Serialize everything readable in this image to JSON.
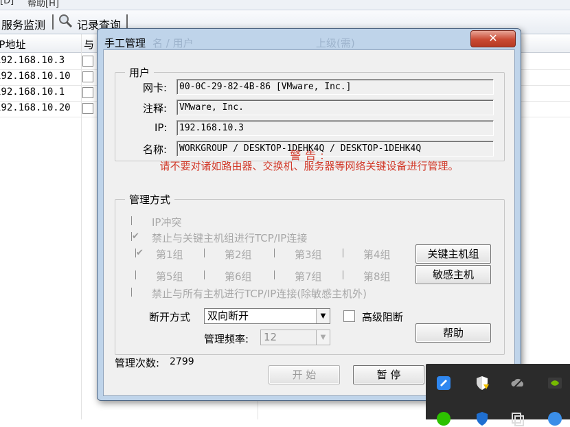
{
  "app": {
    "menubar": {
      "item1": "[D]",
      "item2": "帮助[H]"
    },
    "toolbar": {
      "service_monitor": "服务监测",
      "record_query": "记录查询"
    },
    "grid": {
      "headers": [
        "IP地址",
        "与"
      ],
      "rows": [
        "192.168.10.3",
        "192.168.10.10",
        "192.168.10.1",
        "192.168.10.20"
      ]
    }
  },
  "dialog": {
    "title": "手工管理",
    "ghost_tabs": [
      "名 / 用户",
      "上级(需)"
    ],
    "close_label": "✕",
    "user_group": {
      "legend": "用户",
      "nic_label": "网卡:",
      "nic_value": "00-0C-29-82-4B-86 [VMware, Inc.]",
      "note_label": "注释:",
      "note_value": "VMware, Inc.",
      "ip_label": "IP:",
      "ip_value": "192.168.10.3",
      "name_label": "名称:",
      "name_value": "WORKGROUP / DESKTOP-1DEHK4Q / DESKTOP-1DEHK4Q"
    },
    "warning": {
      "title": "警告:",
      "text": "请不要对诸如路由器、交换机、服务器等网络关键设备进行管理。"
    },
    "manage_group": {
      "legend": "管理方式",
      "ip_conflict": "IP冲突",
      "block_key_groups": "禁止与关键主机组进行TCP/IP连接",
      "groups": [
        "第1组",
        "第2组",
        "第3组",
        "第4组",
        "第5组",
        "第6组",
        "第7组",
        "第8组"
      ],
      "block_all": "禁止与所有主机进行TCP/IP连接(除敏感主机外)",
      "key_host_group_button": "关键主机组",
      "sensitive_host_button": "敏感主机",
      "disconnect_label": "断开方式",
      "disconnect_value": "双向断开",
      "advanced_block_label": "高级阻断",
      "frequency_label": "管理频率:",
      "frequency_value": "12",
      "help_button": "帮助"
    },
    "count_label": "管理次数:",
    "count_value": "2799",
    "start_button": "开 始",
    "pause_button": "暂 停"
  },
  "colors": {
    "warning": "#d23a2a",
    "dialog_frame": "#bfd4ea",
    "close_button": "#c94a33",
    "tray_bg": "#2b2b2b"
  },
  "tray_icons": [
    "blue-app-icon",
    "security-shield-icon",
    "onedrive-cloud-icon",
    "nvidia-icon",
    "wechat-icon",
    "defender-icon",
    "copy-icon",
    "info-icon"
  ]
}
